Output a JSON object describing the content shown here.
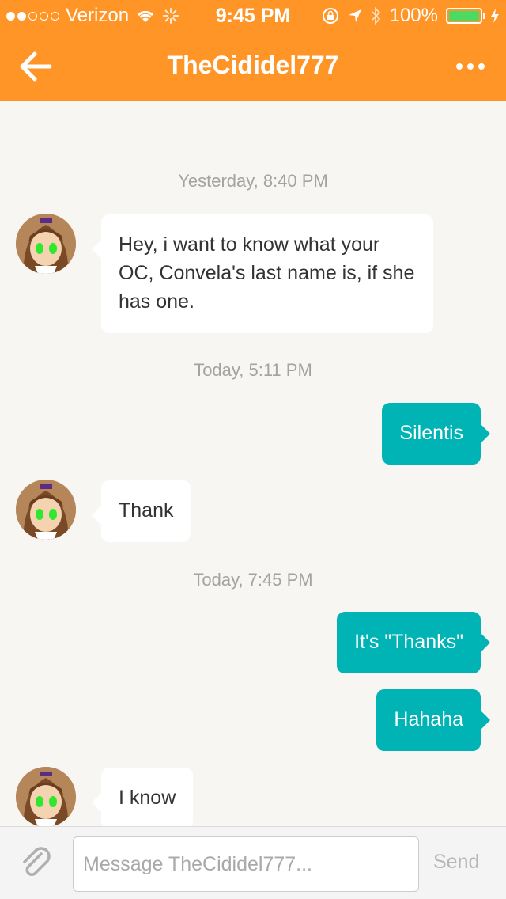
{
  "status_bar": {
    "carrier": "Verizon",
    "time": "9:45 PM",
    "battery_percent": "100%",
    "battery_level": 1.0,
    "signal_strength": 2,
    "signal_total": 5
  },
  "nav": {
    "title": "TheCididel777",
    "back_icon": "back-arrow-icon",
    "more_icon": "more-dots-icon"
  },
  "messages": [
    {
      "type": "timestamp",
      "text": "Yesterday, 8:40 PM"
    },
    {
      "type": "incoming",
      "text": "Hey, i want to know what your OC, Convela's last name is, if she has one."
    },
    {
      "type": "timestamp",
      "text": "Today, 5:11 PM"
    },
    {
      "type": "outgoing",
      "text": "Silentis"
    },
    {
      "type": "incoming",
      "text": "Thank"
    },
    {
      "type": "timestamp",
      "text": "Today, 7:45 PM"
    },
    {
      "type": "outgoing",
      "text": "It's \"Thanks\""
    },
    {
      "type": "outgoing",
      "text": "Hahaha"
    },
    {
      "type": "incoming",
      "text": "I know"
    }
  ],
  "composer": {
    "placeholder": "Message TheCididel777...",
    "value": "",
    "send_label": "Send",
    "attach_icon": "paperclip-icon"
  },
  "colors": {
    "header": "#ff9526",
    "outgoing_bubble": "#00b3b5",
    "incoming_bubble": "#ffffff",
    "background": "#f7f6f2",
    "battery": "#4cd964"
  }
}
